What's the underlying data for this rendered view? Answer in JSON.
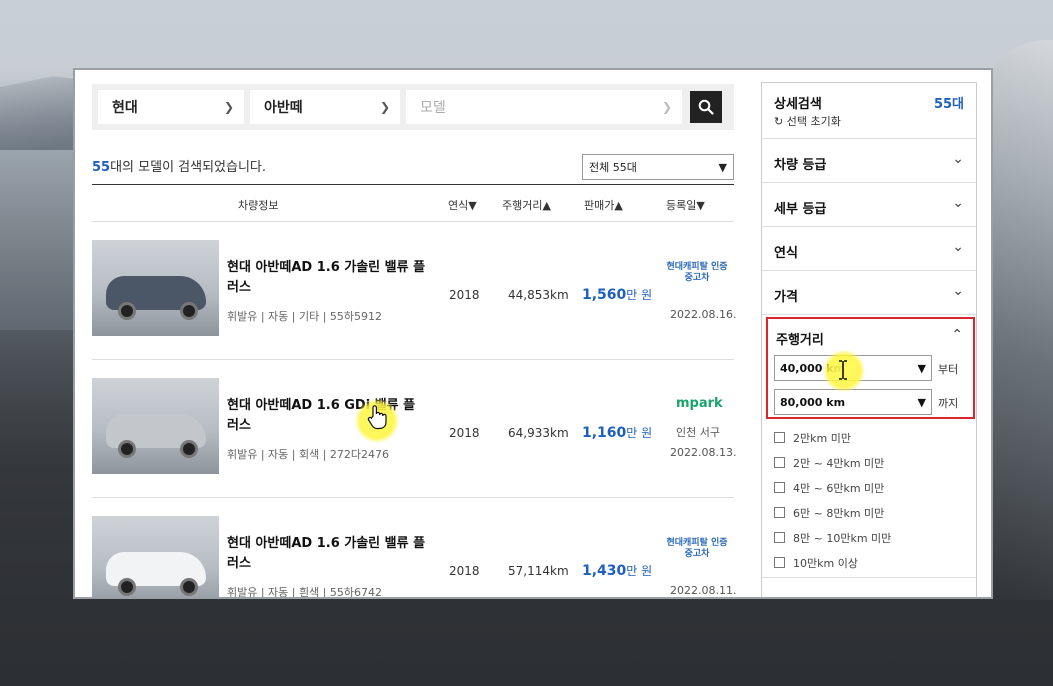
{
  "search": {
    "maker": "현대",
    "model": "아반떼",
    "detail_placeholder": "모델"
  },
  "results": {
    "count": "55",
    "count_suffix": "대의 모델이 검색되었습니다.",
    "total_select": "전체 55대"
  },
  "table_header": {
    "info": "차량정보",
    "year": "연식▼",
    "mileage": "주행거리▲",
    "price": "판매가▲",
    "date": "등록일▼"
  },
  "listings": [
    {
      "title": "현대 아반떼AD 1.6 가솔린 밸류 플러스",
      "meta": "휘발유 | 자동 | 기타 | 55하5912",
      "year": "2018",
      "mileage": "44,853km",
      "price": "1,560",
      "price_unit": "만 원",
      "dealer": "현대캐피탈 인증중고차",
      "date": "2022.08.16.",
      "car_color": "#4b5766"
    },
    {
      "title": "현대 아반떼AD 1.6 GDi 밸류 플러스",
      "meta": "휘발유 | 자동 | 회색 | 272다2476",
      "year": "2018",
      "mileage": "64,933km",
      "price": "1,160",
      "price_unit": "만 원",
      "dealer": "mpark",
      "location": "인천 서구",
      "date": "2022.08.13.",
      "car_color": "#c3c7cc"
    },
    {
      "title": "현대 아반떼AD 1.6 가솔린 밸류 플러스",
      "meta": "휘발유 | 자동 | 흰색 | 55하6742",
      "year": "2018",
      "mileage": "57,114km",
      "price": "1,430",
      "price_unit": "만 원",
      "dealer": "현대캐피탈 인증중고차",
      "date": "2022.08.11.",
      "car_color": "#f2f3f4"
    }
  ],
  "sidebar": {
    "title": "상세검색",
    "count": "55대",
    "reset": "선택 초기화",
    "sections": [
      "차량 등급",
      "세부 등급",
      "연식",
      "가격"
    ],
    "mileage": {
      "title": "주행거리",
      "from_value": "40,000 km",
      "from_suffix": "부터",
      "to_value": "80,000 km",
      "to_suffix": "까지",
      "options": [
        "2만km 미만",
        "2만 ~ 4만km 미만",
        "4만 ~ 6만km 미만",
        "6만 ~ 8만km 미만",
        "8만 ~ 10만km 미만",
        "10만km 이상"
      ]
    }
  },
  "colors": {
    "accent_blue": "#1f5fbd",
    "highlight_red": "#d9262e",
    "mpark_green": "#1aa36d"
  }
}
